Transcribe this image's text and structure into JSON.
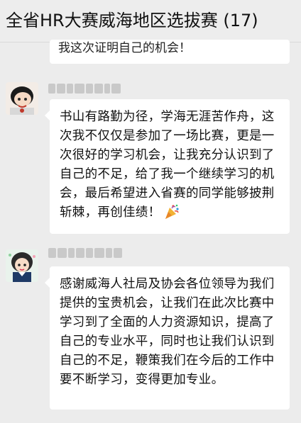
{
  "header": {
    "title": "全省HR大赛威海地区选拔赛 (17)"
  },
  "messages": [
    {
      "partial_text": "我这次证明自己的机会！"
    },
    {
      "text": "书山有路勤为径，学海无涯苦作舟，这次我不仅仅是参加了一场比赛，更是一次很好的学习机会，让我充分认识到了自己的不足，给了我一个继续学习的机会，最后希望进入省赛的同学能够披荆斩棘，再创佳绩！",
      "emoji": "party-popper-icon"
    },
    {
      "text": "感谢威海人社局及协会各位领导为我们提供的宝贵机会，让我们在此次比赛中学习到了全面的人力资源知识，提高了自己的专业水平，同时也让我们认识到自己的不足，鞭策我们在今后的工作中要不断学习，变得更加专业。"
    }
  ]
}
